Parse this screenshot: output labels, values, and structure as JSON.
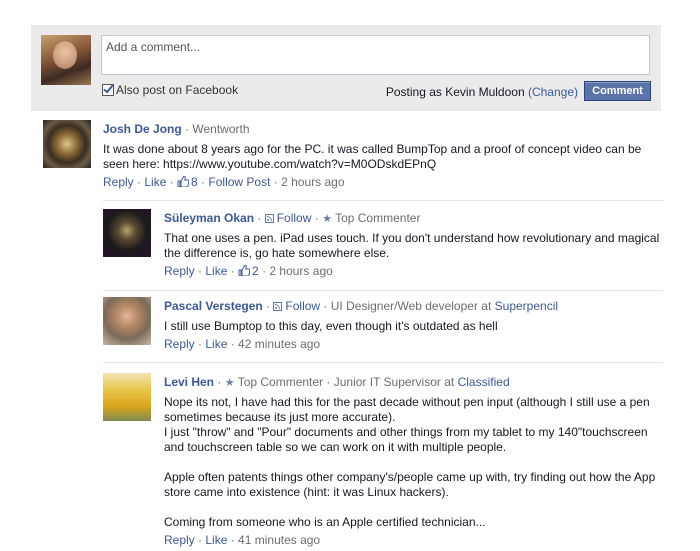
{
  "composer": {
    "placeholder": "Add a comment...",
    "also_post_label": "Also post on Facebook",
    "posting_as_prefix": "Posting as Kevin Muldoon",
    "change_link": "(Change)",
    "comment_button": "Comment"
  },
  "comments": [
    {
      "author": "Josh De Jong",
      "sep": " · ",
      "location": "Wentworth",
      "text": "It was done about 8 years ago for the PC. it was called BumpTop and a proof of concept video can be seen here: https://www.youtube.com/watch?v=M0ODskdEPnQ",
      "reply": "Reply",
      "like": "Like",
      "likes": "8",
      "follow": "Follow Post",
      "time": "2 hours ago"
    },
    {
      "author": "Süleyman Okan",
      "follow": "Follow",
      "badge": "Top Commenter",
      "text": "That one uses a pen. iPad uses touch. If you don't understand how revolutionary and magical the difference is, go hate somewhere else.",
      "reply": "Reply",
      "like": "Like",
      "likes": "2",
      "time": "2 hours ago"
    },
    {
      "author": "Pascal Verstegen",
      "follow": "Follow",
      "role": "UI Designer/Web developer",
      "at": "at",
      "company": "Superpencil",
      "text": "I still use Bumptop to this day, even though it's outdated as hell",
      "reply": "Reply",
      "like": "Like",
      "time": "42 minutes ago"
    },
    {
      "author": "Levi Hen",
      "badge": "Top Commenter",
      "role": "Junior IT Supervisor",
      "at": "at",
      "company": "Classified",
      "text_p1": "Nope its not, I have had this for the past decade without pen input (although I still use a pen sometimes because its just more accurate).",
      "text_p2": "I just \"throw\" and \"Pour\" documents and other things from my tablet to my 140\"touchscreen and touchscreen table so we can work on it with multiple people.",
      "text_p3": "Apple often patents things other company's/people came up with, try finding out how the App store came into existence (hint: it was Linux hackers).",
      "text_p4": "Coming from someone who is an Apple certified technician...",
      "reply": "Reply",
      "like": "Like",
      "time": "41 minutes ago"
    }
  ],
  "separators": {
    "dot": " · "
  },
  "colors": {
    "link": "#3b5998",
    "meta": "#6d6d6d",
    "composer_bg": "#ebebeb",
    "button": "#5b74a8"
  },
  "icons": [
    "like-thumb-icon",
    "rss-follow-icon",
    "star-icon",
    "checkbox-checked-icon"
  ]
}
